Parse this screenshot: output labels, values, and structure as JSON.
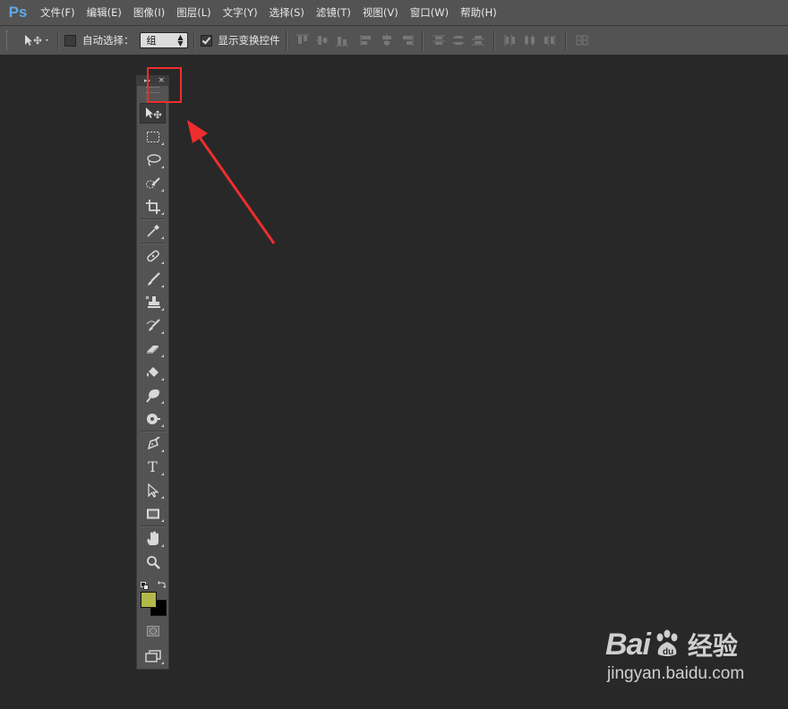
{
  "app": {
    "logo": "Ps"
  },
  "menu": [
    "文件(F)",
    "编辑(E)",
    "图像(I)",
    "图层(L)",
    "文字(Y)",
    "选择(S)",
    "滤镜(T)",
    "视图(V)",
    "窗口(W)",
    "帮助(H)"
  ],
  "options_bar": {
    "auto_select_label": "自动选择：",
    "auto_select_checked": false,
    "auto_select_target": "组",
    "show_transform_label": "显示变换控件",
    "show_transform_checked": true
  },
  "toolbar_panel": {
    "collapse_glyph": "▸▸",
    "close_glyph": "×",
    "tools": [
      {
        "name": "move-tool",
        "icon": "move-icon",
        "active": true
      },
      {
        "name": "marquee-tool",
        "icon": "marquee-icon"
      },
      {
        "name": "lasso-tool",
        "icon": "lasso-icon"
      },
      {
        "name": "quick-selection-tool",
        "icon": "quick-selection-icon"
      },
      {
        "name": "crop-tool",
        "icon": "crop-icon"
      },
      {
        "name": "eyedropper-tool",
        "icon": "eyedropper-icon"
      },
      {
        "name": "spot-healing-tool",
        "icon": "bandage-icon"
      },
      {
        "name": "brush-tool",
        "icon": "brush-icon"
      },
      {
        "name": "clone-stamp-tool",
        "icon": "stamp-icon"
      },
      {
        "name": "history-brush-tool",
        "icon": "history-brush-icon"
      },
      {
        "name": "eraser-tool",
        "icon": "eraser-icon"
      },
      {
        "name": "paint-bucket-tool",
        "icon": "bucket-icon"
      },
      {
        "name": "blur-tool",
        "icon": "blur-icon"
      },
      {
        "name": "dodge-tool",
        "icon": "dodge-icon"
      },
      {
        "name": "pen-tool",
        "icon": "pen-icon"
      },
      {
        "name": "type-tool",
        "icon": "type-icon",
        "glyph": "T"
      },
      {
        "name": "path-selection-tool",
        "icon": "path-selection-icon"
      },
      {
        "name": "rectangle-tool",
        "icon": "rectangle-icon"
      },
      {
        "name": "hand-tool",
        "icon": "hand-icon"
      },
      {
        "name": "zoom-tool",
        "icon": "zoom-icon"
      }
    ],
    "foreground_color": "#b3b84a",
    "background_color": "#000000"
  },
  "annotation": {
    "highlight_color": "#ee2d2d"
  },
  "watermark": {
    "brand": "Bai",
    "brand2": "du",
    "product": "经验",
    "url": "jingyan.baidu.com"
  }
}
